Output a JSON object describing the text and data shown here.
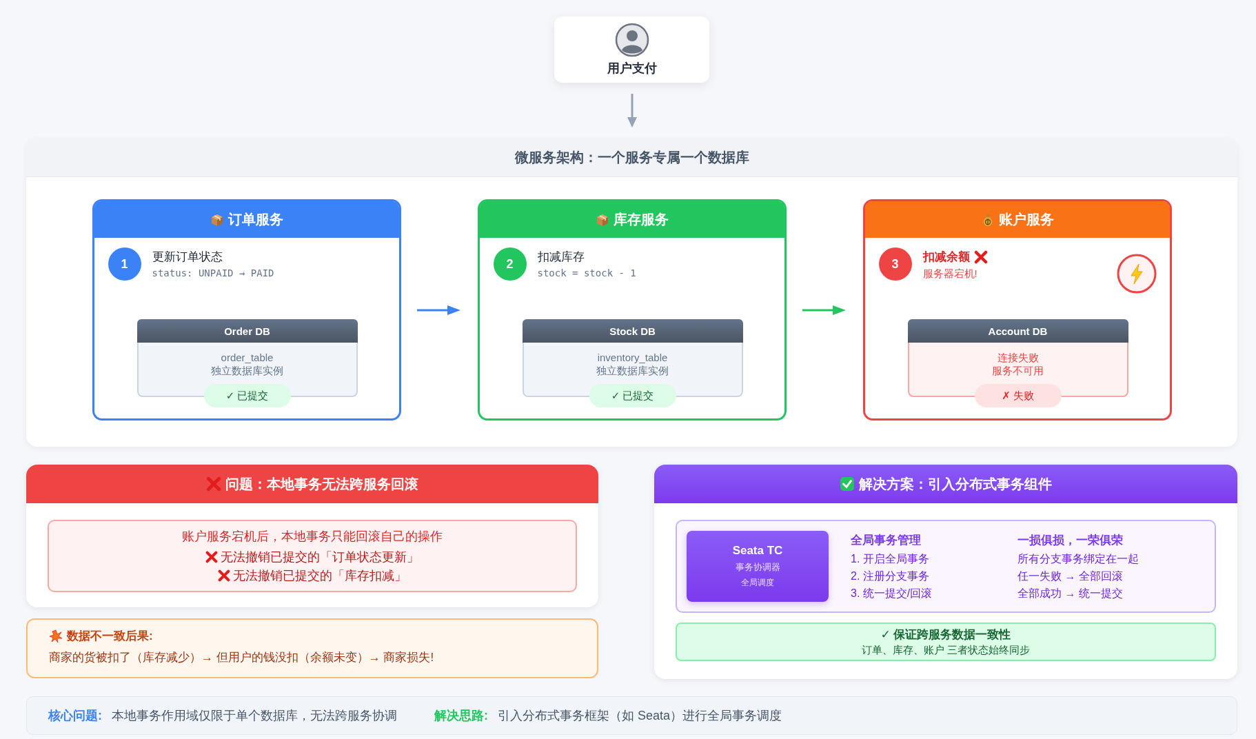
{
  "user": {
    "label": "用户支付"
  },
  "architecture": {
    "title": "微服务架构：一个服务专属一个数据库",
    "services": [
      {
        "kind": "box",
        "title": "订单服务",
        "color": "#3b82f6",
        "number": "1",
        "step_title": "更新订单状态",
        "step_detail": "status: UNPAID → PAID",
        "failed": false,
        "crashed": false,
        "db_title": "Order DB",
        "db_lines": [
          "order_table",
          "独立数据库实例"
        ],
        "badge": "✓ 已提交"
      },
      {
        "kind": "box",
        "title": "库存服务",
        "color": "#22c55e",
        "number": "2",
        "step_title": "扣减库存",
        "step_detail": "stock = stock - 1",
        "failed": false,
        "crashed": false,
        "db_title": "Stock DB",
        "db_lines": [
          "inventory_table",
          "独立数据库实例"
        ],
        "badge": "✓ 已提交"
      },
      {
        "kind": "money",
        "title": "账户服务",
        "color": "#f97316",
        "number": "3",
        "step_title": "扣减余额",
        "step_detail": "服务器宕机!",
        "failed": true,
        "crashed": true,
        "db_title": "Account DB",
        "db_lines": [
          "连接失败",
          "服务不可用"
        ],
        "badge": "✗ 失败"
      }
    ]
  },
  "problem": {
    "title": "问题：本地事务无法跨服务回滚",
    "message": "账户服务宕机后，本地事务只能回滚自己的操作",
    "items": [
      "无法撤销已提交的「订单状态更新」",
      "无法撤销已提交的「库存扣减」"
    ]
  },
  "consequence": {
    "title": "数据不一致后果:",
    "text": "商家的货被扣了（库存减少）→ 但用户的钱没扣（余额未变）→ 商家损失!"
  },
  "solution": {
    "title": "解决方案：引入分布式事务组件",
    "coordinator": {
      "name": "Seata TC",
      "subtitle": "事务协调器",
      "note": "全局调度"
    },
    "columns": [
      {
        "heading": "全局事务管理",
        "lines": [
          "1. 开启全局事务",
          "2. 注册分支事务",
          "3. 统一提交/回滚"
        ]
      },
      {
        "heading": "一损俱损，一荣俱荣",
        "lines": [
          "所有分支事务绑定在一起",
          "任一失败 → 全部回滚",
          "全部成功 → 统一提交"
        ]
      }
    ],
    "guarantee": {
      "title": "✓ 保证跨服务数据一致性",
      "text": "订单、库存、账户 三者状态始终同步"
    }
  },
  "footer": [
    {
      "label": "核心问题:",
      "text": "本地事务作用域仅限于单个数据库，无法跨服务协调",
      "color": "#3b82f6"
    },
    {
      "label": "解决思路:",
      "text": "引入分布式事务框架（如 Seata）进行全局事务调度",
      "color": "#22c55e"
    }
  ]
}
